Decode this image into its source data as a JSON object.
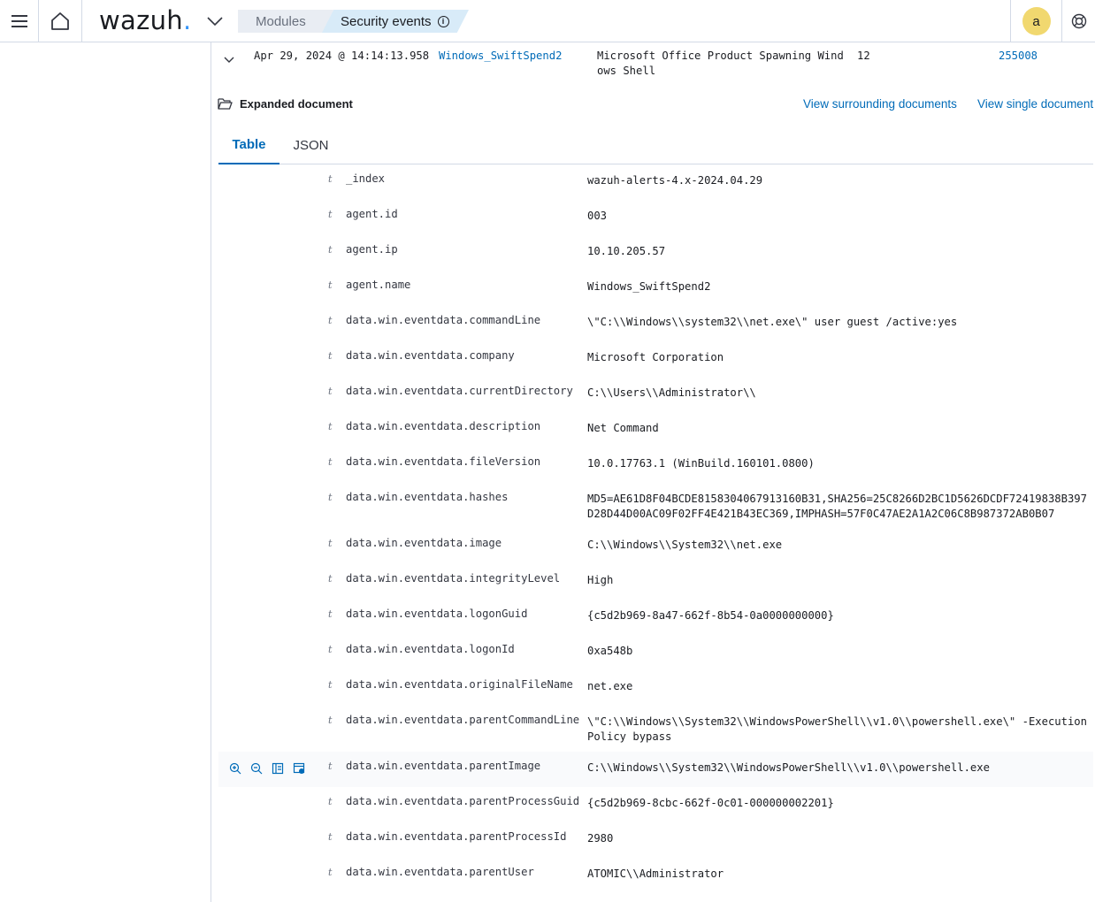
{
  "header": {
    "logo_text": "wazuh",
    "logo_dot": ".",
    "breadcrumb_modules": "Modules",
    "breadcrumb_current": "Security events",
    "avatar_initial": "a"
  },
  "summary": {
    "timestamp": "Apr 29, 2024 @ 14:14:13.958",
    "agent_name": "Windows_SwiftSpend2",
    "description": "Microsoft Office Product Spawning Wind ows Shell",
    "level": "12",
    "rule_id": "255008"
  },
  "expanded": {
    "title": "Expanded document",
    "view_surrounding": "View surrounding documents",
    "view_single": "View single document"
  },
  "tabs": [
    "Table",
    "JSON"
  ],
  "field_type_symbol": "t",
  "fields": [
    {
      "name": "_index",
      "value": "wazuh-alerts-4.x-2024.04.29",
      "link": false
    },
    {
      "name": "agent.id",
      "value": "003",
      "link": true
    },
    {
      "name": "agent.ip",
      "value": "10.10.205.57",
      "link": false
    },
    {
      "name": "agent.name",
      "value": "Windows_SwiftSpend2",
      "link": true
    },
    {
      "name": "data.win.eventdata.commandLine",
      "value": "\\\"C:\\\\Windows\\\\system32\\\\net.exe\\\" user guest /active:yes",
      "link": false
    },
    {
      "name": "data.win.eventdata.company",
      "value": "Microsoft Corporation",
      "link": false
    },
    {
      "name": "data.win.eventdata.currentDirectory",
      "value": "C:\\\\Users\\\\Administrator\\\\",
      "link": false
    },
    {
      "name": "data.win.eventdata.description",
      "value": "Net Command",
      "link": false
    },
    {
      "name": "data.win.eventdata.fileVersion",
      "value": "10.0.17763.1 (WinBuild.160101.0800)",
      "link": false
    },
    {
      "name": "data.win.eventdata.hashes",
      "value": "MD5=AE61D8F04BCDE8158304067913160B31,SHA256=25C8266D2BC1D5626DCDF72419838B397D28D44D00AC09F02FF4E421B43EC369,IMPHASH=57F0C47AE2A1A2C06C8B987372AB0B07",
      "link": false
    },
    {
      "name": "data.win.eventdata.image",
      "value": "C:\\\\Windows\\\\System32\\\\net.exe",
      "link": false
    },
    {
      "name": "data.win.eventdata.integrityLevel",
      "value": "High",
      "link": false
    },
    {
      "name": "data.win.eventdata.logonGuid",
      "value": "{c5d2b969-8a47-662f-8b54-0a0000000000}",
      "link": false
    },
    {
      "name": "data.win.eventdata.logonId",
      "value": "0xa548b",
      "link": false
    },
    {
      "name": "data.win.eventdata.originalFileName",
      "value": "net.exe",
      "link": false
    },
    {
      "name": "data.win.eventdata.parentCommandLine",
      "value": "\\\"C:\\\\Windows\\\\System32\\\\WindowsPowerShell\\\\v1.0\\\\powershell.exe\\\" -ExecutionPolicy bypass",
      "link": false
    },
    {
      "name": "data.win.eventdata.parentImage",
      "value": "C:\\\\Windows\\\\System32\\\\WindowsPowerShell\\\\v1.0\\\\powershell.exe",
      "link": false
    },
    {
      "name": "data.win.eventdata.parentProcessGuid",
      "value": "{c5d2b969-8cbc-662f-0c01-000000002201}",
      "link": false
    },
    {
      "name": "data.win.eventdata.parentProcessId",
      "value": "2980",
      "link": false
    },
    {
      "name": "data.win.eventdata.parentUser",
      "value": "ATOMIC\\\\Administrator",
      "link": false
    }
  ]
}
